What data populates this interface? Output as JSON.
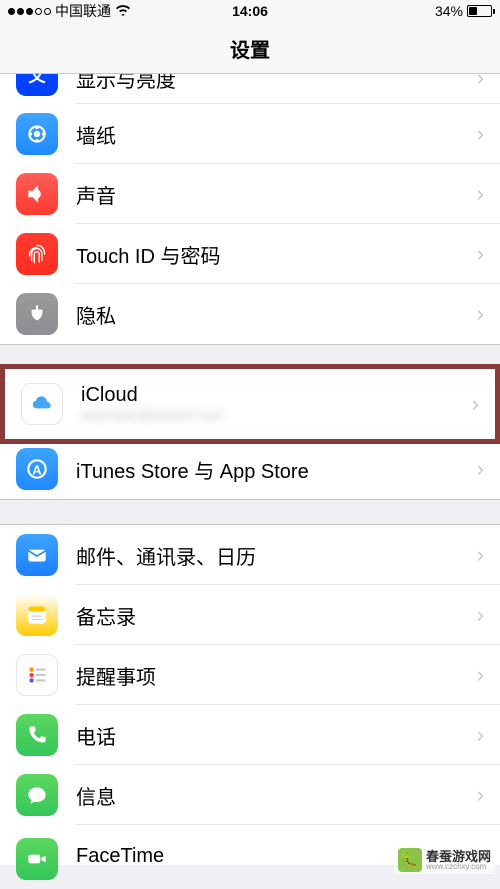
{
  "status": {
    "carrier": "中国联通",
    "time": "14:06",
    "battery_pct": "34%"
  },
  "nav": {
    "title": "设置"
  },
  "groups": [
    {
      "rows": [
        {
          "icon": "display-brightness",
          "label": "显示与亮度",
          "partial": true
        },
        {
          "icon": "wallpaper",
          "label": "墙纸"
        },
        {
          "icon": "sound",
          "label": "声音"
        },
        {
          "icon": "touchid",
          "label": "Touch ID 与密码"
        },
        {
          "icon": "privacy",
          "label": "隐私"
        }
      ]
    },
    {
      "rows": [
        {
          "icon": "icloud",
          "label": "iCloud",
          "sub": "example@icloud.com",
          "highlight": true
        },
        {
          "icon": "itunes",
          "label": "iTunes Store 与 App Store"
        }
      ]
    },
    {
      "rows": [
        {
          "icon": "mail",
          "label": "邮件、通讯录、日历"
        },
        {
          "icon": "notes",
          "label": "备忘录"
        },
        {
          "icon": "reminders",
          "label": "提醒事项"
        },
        {
          "icon": "phone",
          "label": "电话"
        },
        {
          "icon": "messages",
          "label": "信息"
        },
        {
          "icon": "facetime",
          "label": "FaceTime",
          "partial_bottom": true
        }
      ]
    }
  ],
  "watermark": {
    "main": "春蚕游戏网",
    "sub": "www.czchxy.com"
  }
}
